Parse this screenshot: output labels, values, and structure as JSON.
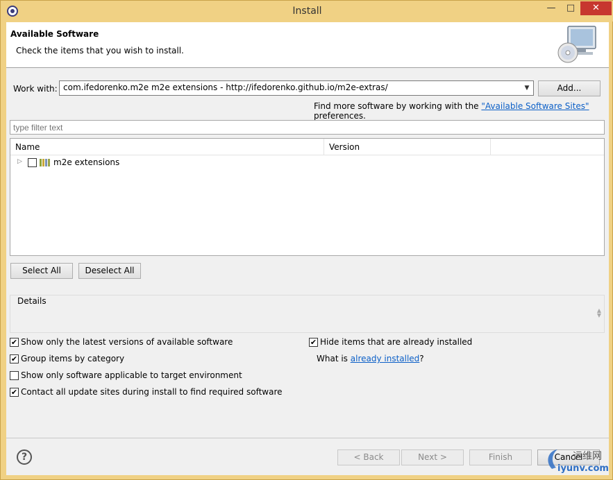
{
  "window": {
    "title": "Install",
    "minimize_glyph": "—",
    "maximize_glyph": "□",
    "close_glyph": "✕",
    "app_icon": "eclipse-icon"
  },
  "banner": {
    "title": "Available Software",
    "description": "Check the items that you wish to install.",
    "image_icon": "cd-monitor-icon"
  },
  "work_with": {
    "label": "Work with:",
    "value": "com.ifedorenko.m2e m2e extensions - http://ifedorenko.github.io/m2e-extras/",
    "add_label": "Add..."
  },
  "find_more": {
    "prefix": "Find more software by working with the ",
    "link": "\"Available Software Sites\"",
    "suffix": " preferences."
  },
  "filter": {
    "placeholder": "type filter text"
  },
  "tree": {
    "columns": [
      "Name",
      "Version"
    ],
    "rows": [
      {
        "name": "m2e extensions",
        "version": "",
        "checked": false,
        "icon": "category-icon"
      }
    ]
  },
  "selection_buttons": {
    "select_all": "Select All",
    "deselect_all": "Deselect All"
  },
  "details": {
    "label": "Details"
  },
  "options": {
    "latest_versions": {
      "label": "Show only the latest versions of available software",
      "checked": true
    },
    "group_by_category": {
      "label": "Group items by category",
      "checked": true
    },
    "target_env": {
      "label": "Show only software applicable to target environment",
      "checked": false
    },
    "contact_sites": {
      "label": "Contact all update sites during install to find required software",
      "checked": true
    },
    "hide_installed": {
      "label": "Hide items that are already installed",
      "checked": true
    },
    "what_is": {
      "prefix": "What is ",
      "link": "already installed",
      "suffix": "?"
    }
  },
  "footer": {
    "help_glyph": "?",
    "back": "< Back",
    "next": "Next >",
    "finish": "Finish",
    "cancel": "Cancel"
  },
  "watermark": {
    "text_top": "运维网",
    "text_bottom": "iyunv.com"
  },
  "colors": {
    "titlebar": "#f0d184",
    "close_button": "#c7372f",
    "link": "#0b5fc7",
    "dialog_bg": "#f0f0f0"
  }
}
